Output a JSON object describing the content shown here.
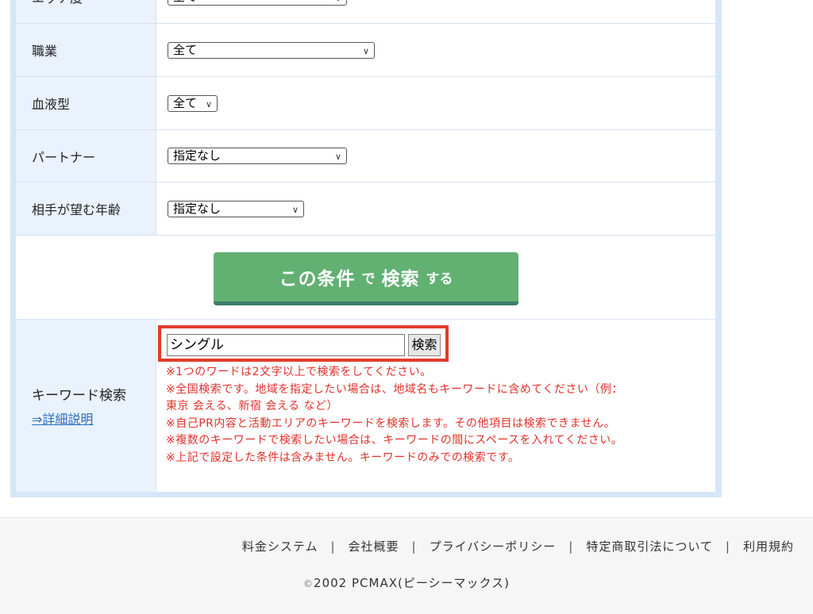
{
  "form": {
    "rows": [
      {
        "label": "エッチ度",
        "value": "全て"
      },
      {
        "label": "職業",
        "value": "全て"
      },
      {
        "label": "血液型",
        "value": "全て"
      },
      {
        "label": "パートナー",
        "value": "指定なし"
      },
      {
        "label": "相手が望む年齢",
        "value": "指定なし"
      }
    ],
    "search_button": {
      "part1": "この条件",
      "part2": "で",
      "part3": "検索",
      "part4": "する"
    }
  },
  "keyword": {
    "label": "キーワード検索",
    "detail_link": "⇒詳細説明",
    "input_value": "シングル",
    "button_label": "検索",
    "notes": [
      "※1つのワードは2文字以上で検索をしてください。",
      "※全国検索です。地域を指定したい場合は、地域名もキーワードに含めてください（例：",
      "東京 会える、新宿 会える など）",
      "※自己PR内容と活動エリアのキーワードを検索します。その他項目は検索できません。",
      "※複数のキーワードで検索したい場合は、キーワードの間にスペースを入れてください。",
      "※上記で設定した条件は含みません。キーワードのみでの検索です。"
    ]
  },
  "footer": {
    "links": [
      "料金システム",
      "会社概要",
      "プライバシーポリシー",
      "特定商取引法について",
      "利用規約"
    ],
    "separator": "|",
    "copyright_symbol": "©",
    "copyright_text": "2002 PCMAX(ピーシーマックス)"
  },
  "colors": {
    "button_green": "#62b072",
    "highlight_red": "#e23c2a",
    "note_red": "#e0312a",
    "label_bg": "#e9f2fd"
  }
}
